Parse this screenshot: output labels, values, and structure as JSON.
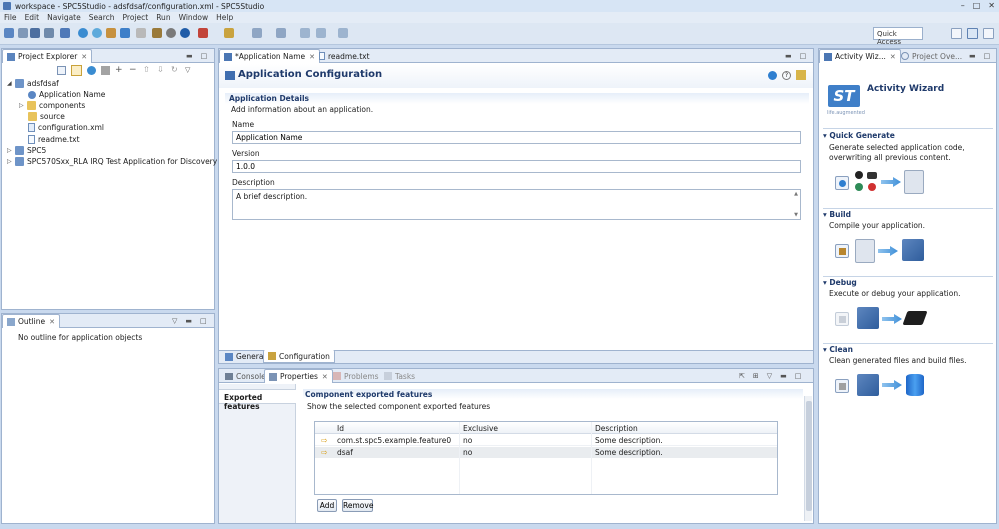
{
  "window": {
    "title": "workspace - SPC5Studio - adsfdsaf/configuration.xml - SPC5Studio"
  },
  "menu": [
    "File",
    "Edit",
    "Navigate",
    "Search",
    "Project",
    "Run",
    "Window",
    "Help"
  ],
  "toolbar": {
    "quick_access": "Quick Access"
  },
  "project_explorer": {
    "tab": "Project Explorer",
    "tree": [
      {
        "label": "adsfdsaf",
        "level": 0,
        "kind": "project",
        "expanded": true
      },
      {
        "label": "Application Name",
        "level": 1,
        "kind": "item"
      },
      {
        "label": "components",
        "level": 1,
        "kind": "folder"
      },
      {
        "label": "source",
        "level": 1,
        "kind": "folder"
      },
      {
        "label": "configuration.xml",
        "level": 1,
        "kind": "file"
      },
      {
        "label": "readme.txt",
        "level": 1,
        "kind": "file"
      },
      {
        "label": "SPC5",
        "level": 0,
        "kind": "project"
      },
      {
        "label": "SPC570Sxx_RLA IRQ Test Application for Discovery",
        "level": 0,
        "kind": "project"
      }
    ]
  },
  "outline": {
    "tab": "Outline",
    "empty_text": "No outline for application objects"
  },
  "editor": {
    "tabs": [
      "*Application Name",
      "readme.txt"
    ],
    "header_title": "Application Configuration",
    "section_title": "Application Details",
    "section_desc": "Add information about an application.",
    "name_label": "Name",
    "name_value": "Application Name",
    "version_label": "Version",
    "version_value": "1.0.0",
    "description_label": "Description",
    "description_value": "A brief description.",
    "bottom_tabs": [
      "General",
      "Configuration"
    ]
  },
  "bottom_panel": {
    "tabs": [
      "Console",
      "Properties",
      "Problems",
      "Tasks"
    ],
    "left_tab": "Exported features",
    "section_title": "Component exported features",
    "section_desc": "Show the selected component exported features",
    "columns": [
      "Id",
      "Exclusive",
      "Description"
    ],
    "rows": [
      {
        "id": "com.st.spc5.example.feature0",
        "exclusive": "no",
        "description": "Some description."
      },
      {
        "id": "dsaf",
        "exclusive": "no",
        "description": "Some description."
      }
    ],
    "add_label": "Add",
    "remove_label": "Remove"
  },
  "wizard": {
    "tabs": [
      "Activity Wiz...",
      "Project Ove..."
    ],
    "title": "Activity Wizard",
    "logo_tagline": "life.augmented",
    "sections": [
      {
        "title": "Quick Generate",
        "desc": "Generate selected application code, overwriting all previous content."
      },
      {
        "title": "Build",
        "desc": "Compile your application."
      },
      {
        "title": "Debug",
        "desc": "Execute or debug your application."
      },
      {
        "title": "Clean",
        "desc": "Clean generated files and build files."
      }
    ]
  }
}
